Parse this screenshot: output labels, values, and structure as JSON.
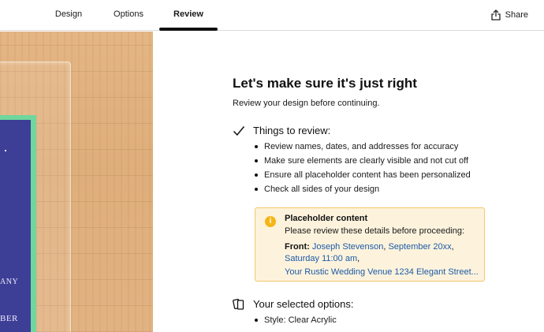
{
  "header": {
    "tabs": [
      {
        "label": "Design"
      },
      {
        "label": "Options"
      },
      {
        "label": "Review",
        "active": true
      }
    ],
    "share_label": "Share"
  },
  "preview": {
    "card_text_1": "ANY",
    "card_text_2": "BER"
  },
  "review": {
    "title": "Let's make sure it's just right",
    "subtitle": "Review your design before continuing.",
    "things_heading": "Things to review:",
    "things": [
      "Review names, dates, and addresses for accuracy",
      "Make sure elements are clearly visible and not cut off",
      "Ensure all placeholder content has been personalized",
      "Check all sides of your design"
    ],
    "placeholder": {
      "title": "Placeholder content",
      "description": "Please review these details before proceeding:",
      "side_label": "Front:",
      "items": [
        "Joseph Stevenson",
        "September 20xx",
        "Saturday 11:00 am",
        "Your Rustic Wedding Venue 1234 Elegant Street..."
      ],
      "separator": ", ",
      "trailing_comma": ","
    },
    "options_heading": "Your selected options:",
    "options": [
      "Style: Clear Acrylic"
    ]
  },
  "colors": {
    "link": "#1c5aa6",
    "alert_bg": "#fdf3dd",
    "alert_border": "#f4c76a",
    "alert_icon": "#f4b518",
    "card_navy": "#3d3f97",
    "card_green": "#6fd79e"
  },
  "icons": {
    "share": "share-icon",
    "check": "checkmark-icon",
    "info": "info-icon",
    "options": "product-options-icon"
  }
}
